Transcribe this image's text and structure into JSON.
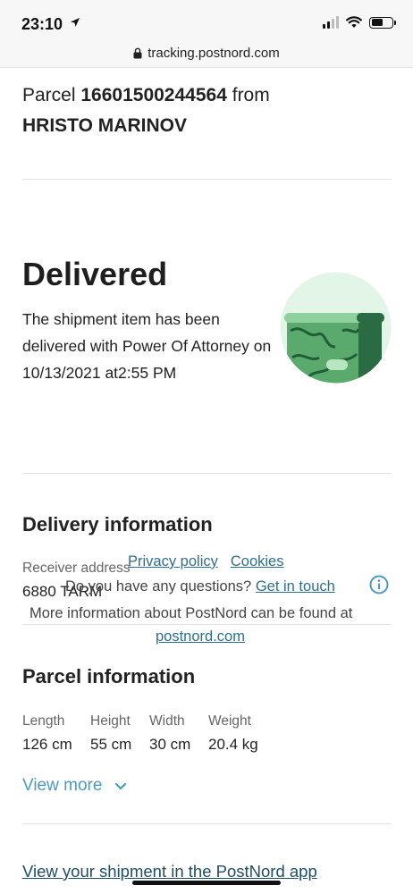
{
  "status_bar": {
    "time": "23:10",
    "icons": [
      "location-arrow-icon",
      "cellular-signal-icon",
      "wifi-icon",
      "battery-icon"
    ]
  },
  "browser": {
    "url": "tracking.postnord.com",
    "lock_icon": "lock-icon"
  },
  "parcel": {
    "prefix": "Parcel",
    "number": "16601500244564",
    "from_word": "from",
    "sender": "HRISTO MARINOV"
  },
  "status": {
    "title": "Delivered",
    "description": "The shipment item has been delivered with Power Of Attorney on 10/13/2021 at2:55 PM",
    "illustration": "delivered-parcel-illustration"
  },
  "delivery_info": {
    "heading": "Delivery information",
    "receiver_label": "Receiver address",
    "receiver_value": "6880 TARM"
  },
  "footer_overlay": {
    "privacy_policy": "Privacy policy",
    "cookies": "Cookies",
    "questions_text": "Do you have any questions?",
    "get_in_touch": "Get in touch",
    "more_info_text": "More information about PostNord can be found at",
    "postnord_link": "postnord.com"
  },
  "parcel_info": {
    "heading": "Parcel information",
    "specs": [
      {
        "label": "Length",
        "value": "126 cm"
      },
      {
        "label": "Height",
        "value": "55 cm"
      },
      {
        "label": "Width",
        "value": "30 cm"
      },
      {
        "label": "Weight",
        "value": "20.4 kg"
      }
    ],
    "view_more": "View more"
  },
  "app_link": "View your shipment in the PostNord app",
  "colors": {
    "link_blue": "#4a9bc2",
    "overlay_link": "#2e6f8c",
    "illustration_bg": "#e3f5e7",
    "illustration_dark": "#2b6b43"
  }
}
